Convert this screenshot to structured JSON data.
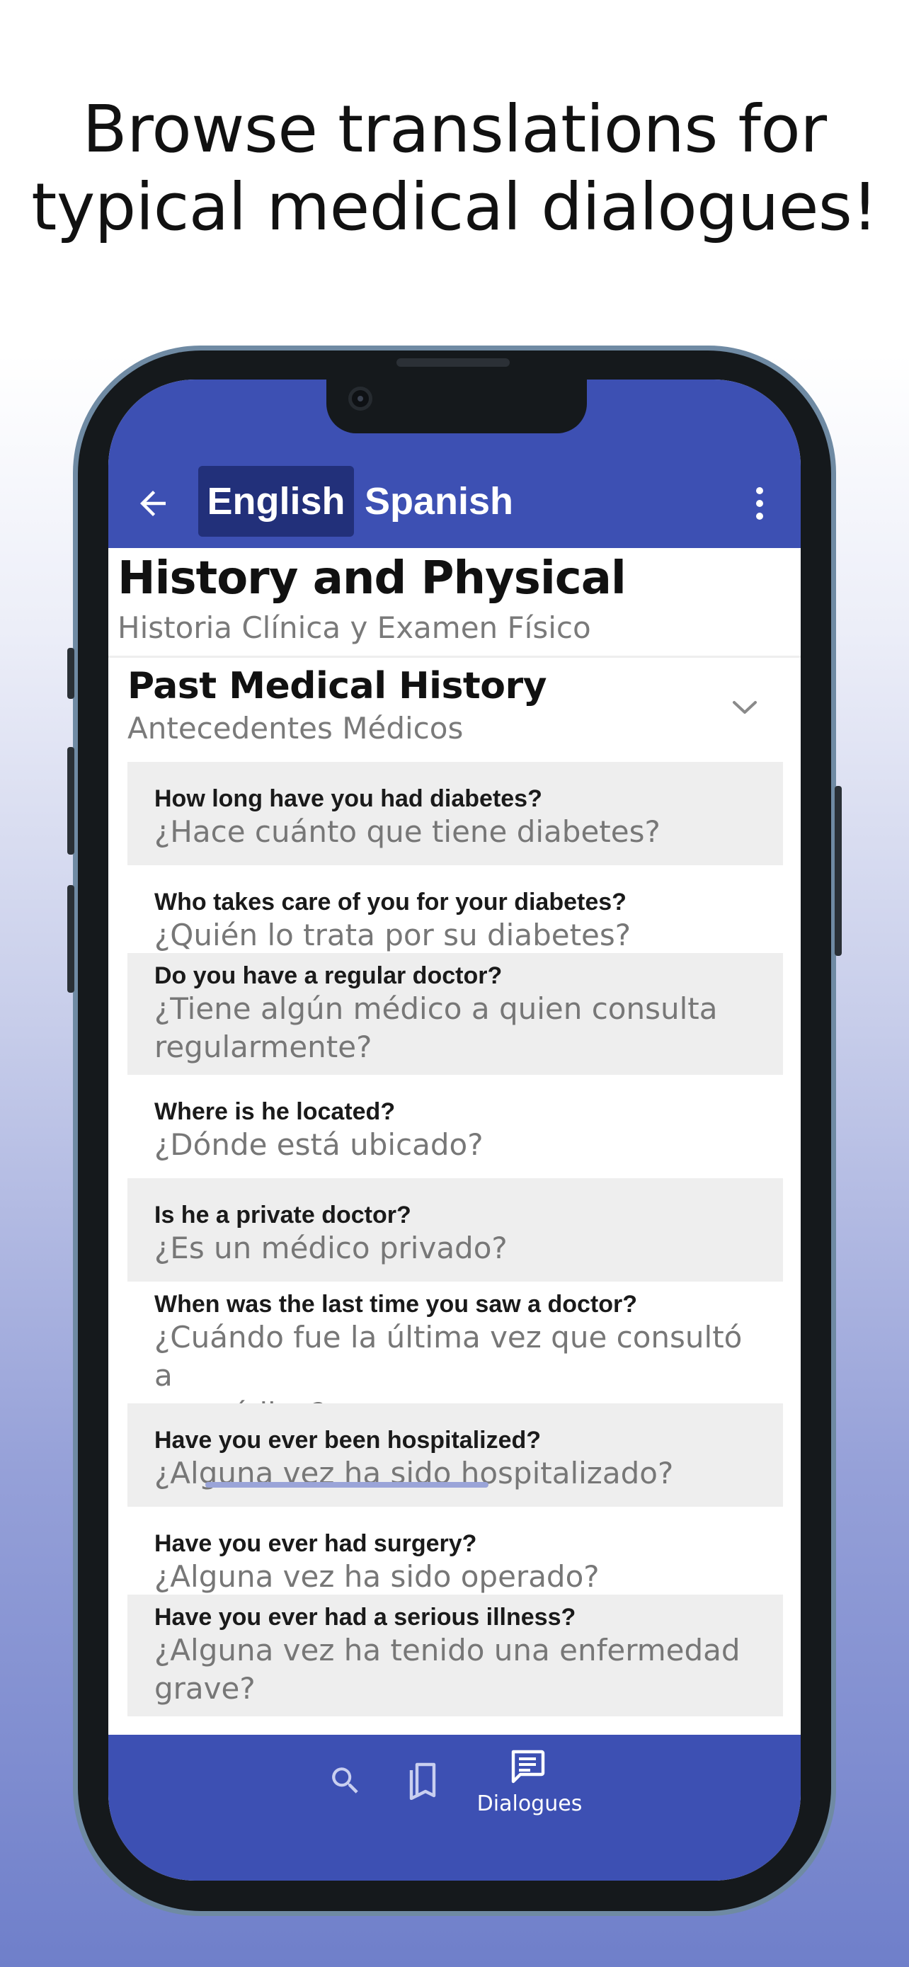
{
  "headline": {
    "line1": "Browse translations for",
    "line2": "typical medical dialogues!"
  },
  "app_bar": {
    "back_icon": "arrow-left-icon",
    "tabs": [
      {
        "label": "English",
        "active": true
      },
      {
        "label": "Spanish",
        "active": false
      }
    ],
    "menu_icon": "more-vertical-icon",
    "color": "#3d50b3"
  },
  "page": {
    "title": "History and Physical",
    "subtitle": "Historia Clínica y Examen Físico"
  },
  "section": {
    "title": "Past Medical History",
    "subtitle": "Antecedentes Médicos",
    "expand_icon": "chevron-down-icon"
  },
  "rows": [
    {
      "en": "How long have you had diabetes?",
      "es": [
        "¿Hace cuánto que tiene diabetes?"
      ]
    },
    {
      "en": "Who takes care of you for your diabetes?",
      "es": [
        "¿Quién lo trata por su diabetes?"
      ]
    },
    {
      "en": "Do you have a regular doctor?",
      "es": [
        "¿Tiene algún médico a quien consulta",
        "regularmente?"
      ]
    },
    {
      "en": "Where is he located?",
      "es": [
        "¿Dónde está ubicado?"
      ]
    },
    {
      "en": "Is he a private doctor?",
      "es": [
        "¿Es un médico privado?"
      ]
    },
    {
      "en": "When was the last time you saw a doctor?",
      "es": [
        "¿Cuándo fue la última vez que consultó a",
        "un médico?"
      ]
    },
    {
      "en": "Have you ever been hospitalized?",
      "es": [
        "¿Alguna vez ha sido hospitalizado?"
      ]
    },
    {
      "en": "Have you ever had surgery?",
      "es": [
        "¿Alguna vez ha sido operado?"
      ]
    },
    {
      "en": "Have you ever had a serious illness?",
      "es": [
        "¿Alguna vez ha tenido una enfermedad",
        "grave?"
      ]
    }
  ],
  "bottom_nav": {
    "items": [
      {
        "icon": "search-icon",
        "label": ""
      },
      {
        "icon": "bookmarks-icon",
        "label": ""
      },
      {
        "icon": "dialogues-icon",
        "label": "Dialogues"
      }
    ]
  }
}
